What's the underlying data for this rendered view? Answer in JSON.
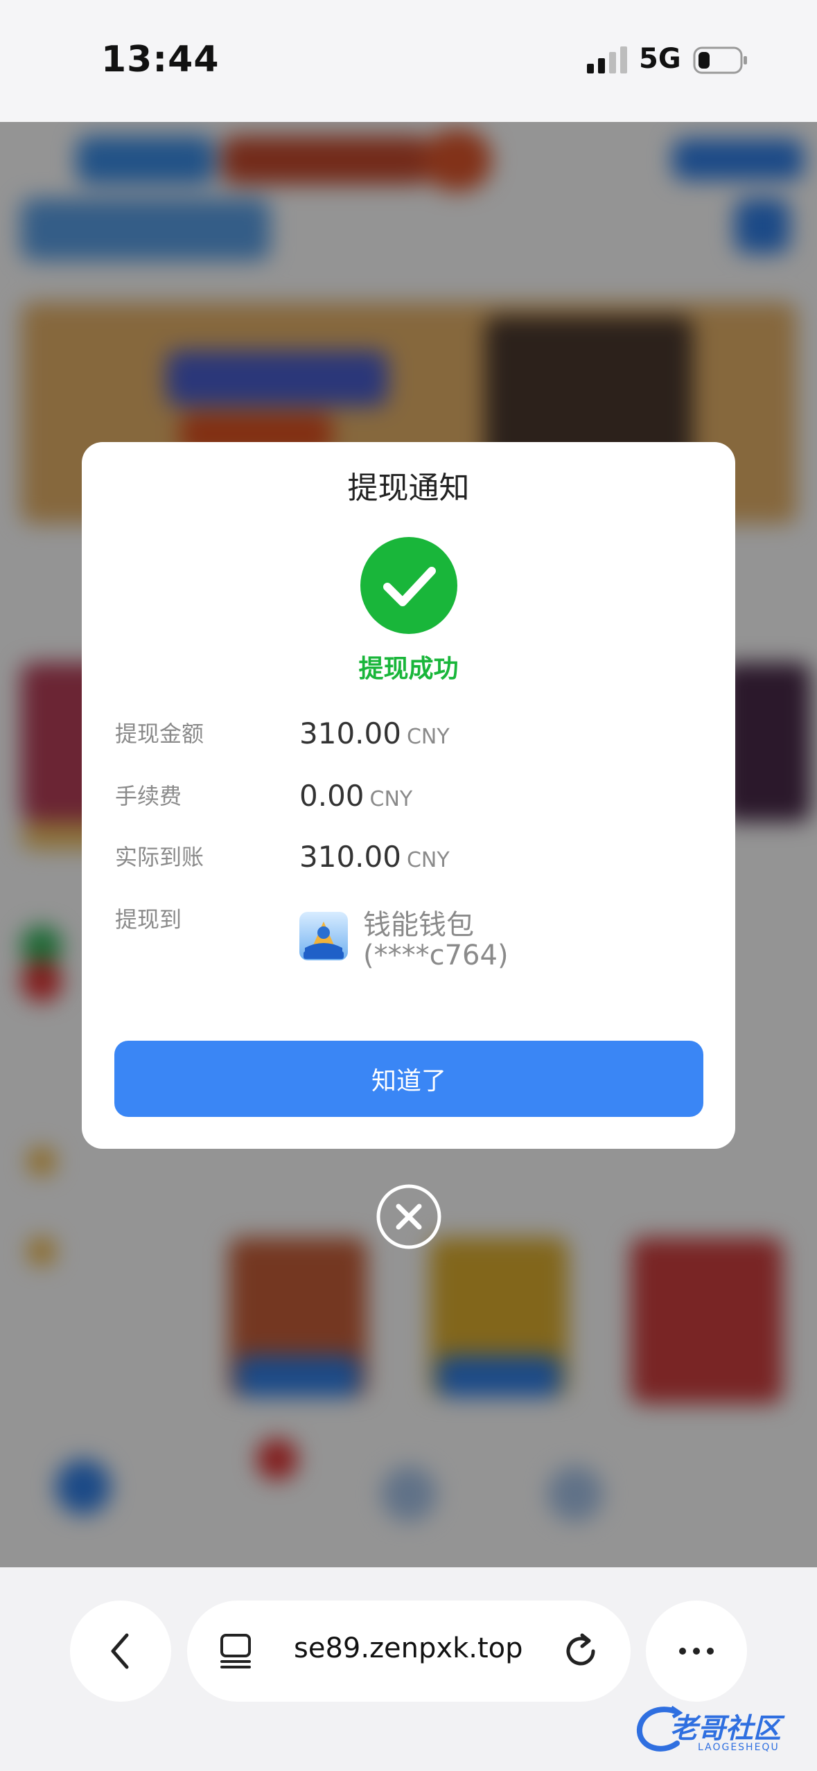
{
  "status_bar": {
    "time": "13:44",
    "network": "5G"
  },
  "modal": {
    "title": "提现通知",
    "status": "提现成功",
    "rows": [
      {
        "label": "提现金额",
        "value": "310.00",
        "unit": "CNY"
      },
      {
        "label": "手续费",
        "value": "0.00",
        "unit": "CNY"
      },
      {
        "label": "实际到账",
        "value": "310.00",
        "unit": "CNY"
      }
    ],
    "destination": {
      "label": "提现到",
      "wallet_name": "钱能钱包",
      "account": "(****c764)",
      "logo_text": "钱能钱包"
    },
    "confirm_label": "知道了"
  },
  "browser": {
    "url": "se89.zenpxk.top"
  },
  "watermark": {
    "text": "老哥社区",
    "sub": "LAOGESHEQU"
  },
  "colors": {
    "success_green": "#19b63a",
    "button_blue": "#3a86f5"
  }
}
